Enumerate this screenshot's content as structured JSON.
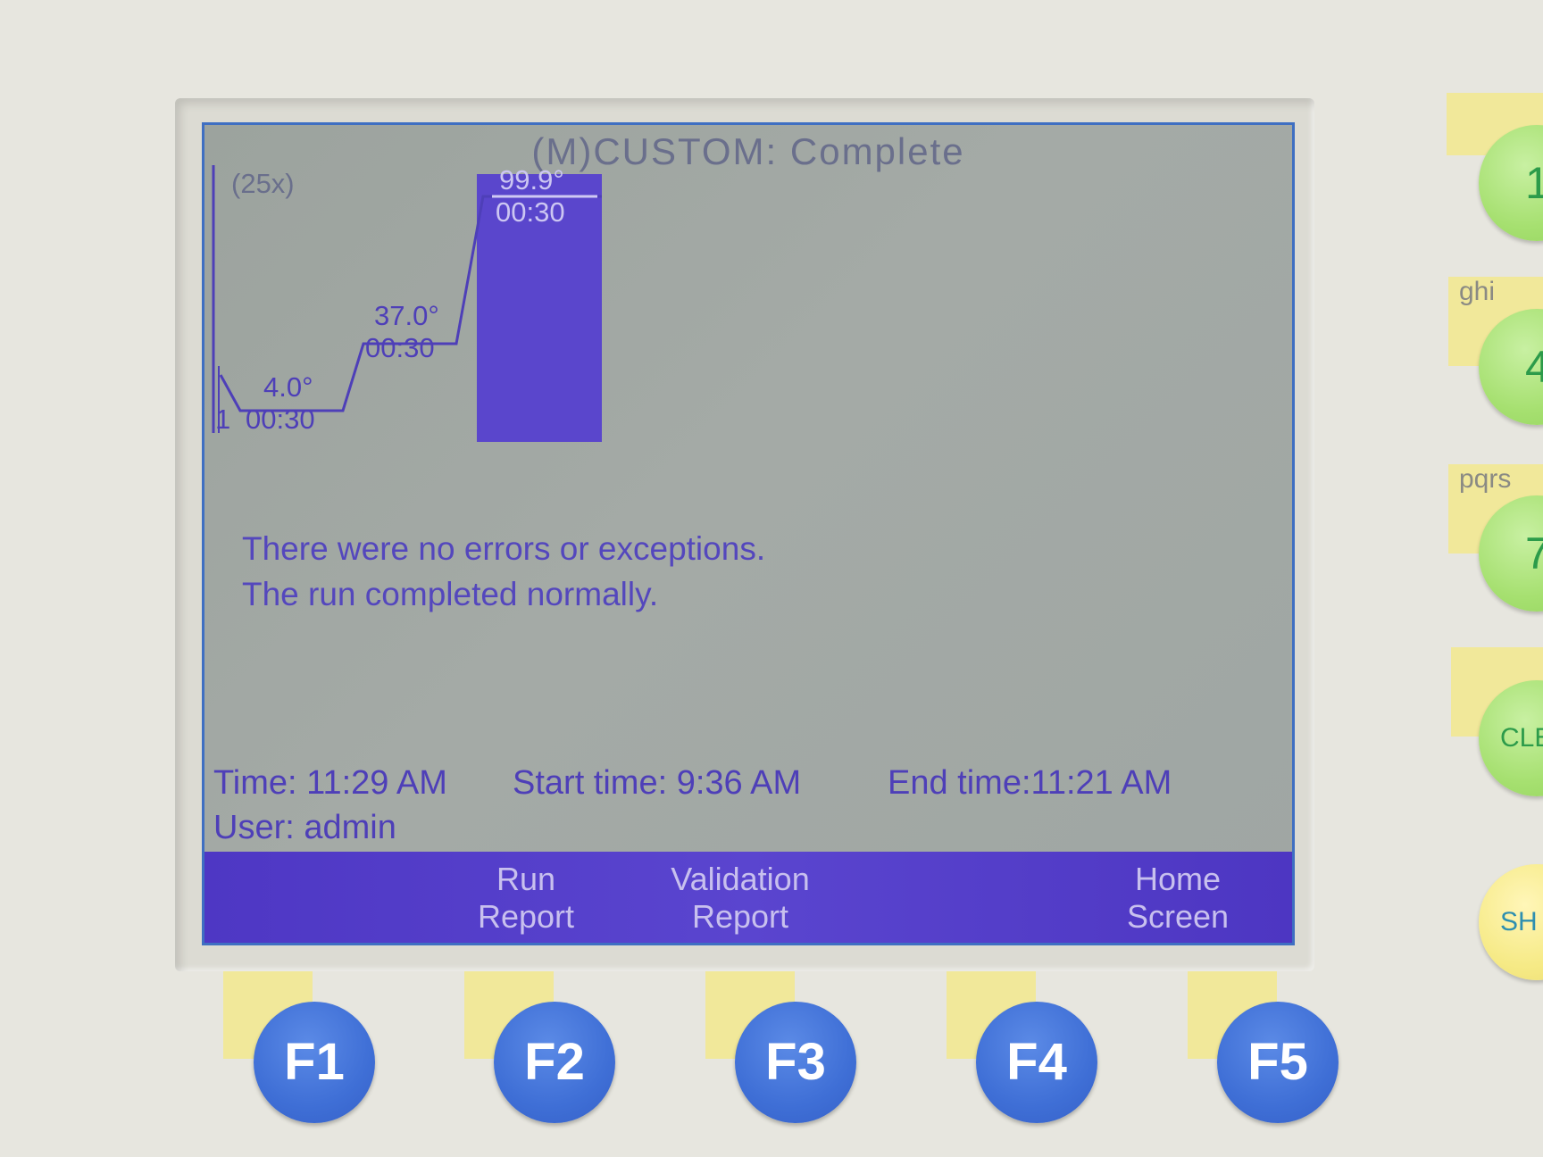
{
  "screen": {
    "title": "(M)CUSTOM: Complete",
    "cycles": "(25x)",
    "steps": [
      {
        "temp": "4.0°",
        "time": "00:30"
      },
      {
        "temp": "37.0°",
        "time": "00:30"
      },
      {
        "temp": "99.9°",
        "time": "00:30"
      }
    ],
    "step_prefix": "1",
    "messages": [
      "There were no errors or exceptions.",
      "The run completed normally."
    ],
    "time": "Time: 11:29 AM",
    "start_time": "Start time: 9:36 AM",
    "end_time": "End time:11:21 AM",
    "user": "User: admin"
  },
  "softkeys": [
    "",
    "Run\nReport",
    "Validation\nReport",
    "",
    "Home\nScreen"
  ],
  "function_keys": [
    "F1",
    "F2",
    "F3",
    "F4",
    "F5"
  ],
  "keypad": {
    "keys": [
      "1",
      "4",
      "7",
      "CLE",
      "SH"
    ],
    "labels": [
      "ghi",
      "pqrs"
    ]
  },
  "colors": {
    "accent": "#4e3fb8",
    "softbar": "#5240c8",
    "fkey": "#4677dc",
    "keypad": "#a6e070"
  }
}
